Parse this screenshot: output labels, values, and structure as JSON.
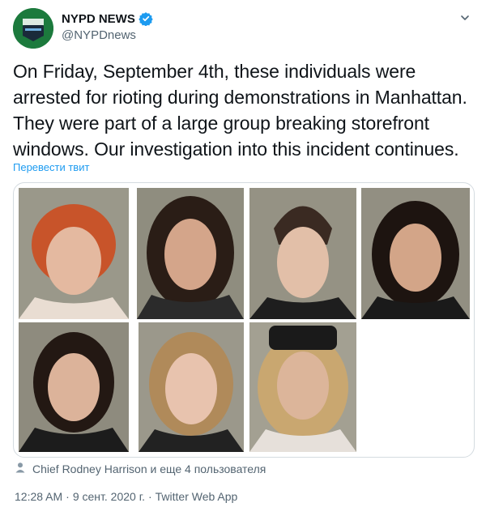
{
  "author": {
    "display_name": "NYPD NEWS",
    "handle": "@NYPDnews",
    "verified_icon": "verified-badge-icon"
  },
  "tweet": {
    "text": "On Friday, September 4th, these individuals were arrested for rioting during demonstrations in Manhattan. They were part of a large group breaking storefront windows. Our investigation into this incident continues.",
    "translate_label": "Перевести твит"
  },
  "media": {
    "photo_count": 7
  },
  "engagement": {
    "liked_by": "Chief Rodney Harrison и еще 4 пользователя"
  },
  "meta": {
    "time": "12:28 AM",
    "date": "9 сент. 2020 г.",
    "source": "Twitter Web App",
    "separator": "·"
  },
  "colors": {
    "link": "#1d9bf0",
    "text": "#0f1419",
    "secondary": "#536471",
    "border": "#d4dbe0",
    "avatar_bg": "#1c7a3d"
  }
}
